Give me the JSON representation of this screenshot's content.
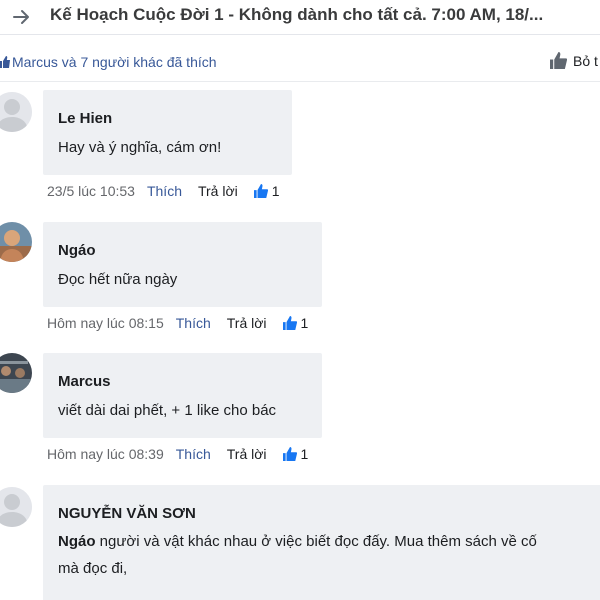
{
  "thread": {
    "title": "Kế Hoạch Cuộc Đời 1 - Không dành cho tất cả. 7:00 AM, 18/..."
  },
  "likes_bar": {
    "summary": "Marcus và 7 người khác đã thích",
    "mark_read_label": "Bỏ t"
  },
  "comments": [
    {
      "author": "Le Hien",
      "text": "Hay và ý nghĩa, cám ơn!",
      "time": "23/5 lúc 10:53",
      "like_label": "Thích",
      "reply_label": "Trả lời",
      "like_count": "1",
      "avatar": "default-avatar"
    },
    {
      "author": "Ngáo",
      "text": "Đọc hết nữa ngày",
      "time": "Hôm nay lúc 08:15",
      "like_label": "Thích",
      "reply_label": "Trả lời",
      "like_count": "1",
      "avatar": "photo-avatar"
    },
    {
      "author": "Marcus",
      "text": "viết dài dai phết, + 1 like cho bác",
      "time": "Hôm nay lúc 08:39",
      "like_label": "Thích",
      "reply_label": "Trả lời",
      "like_count": "1",
      "avatar": "photo-avatar"
    },
    {
      "author": "NGUYỄN VĂN SƠN",
      "mention": "Ngáo",
      "text_line1": " người và vật khác nhau ở việc biết đọc đấy. Mua thêm sách về cố",
      "text_line2": "mà đọc đi,",
      "avatar": "default-avatar"
    }
  ],
  "colors": {
    "link_blue": "#385898",
    "like_blue": "#1877f2",
    "bubble_bg": "#eef0f3",
    "meta_gray": "#65676b"
  }
}
